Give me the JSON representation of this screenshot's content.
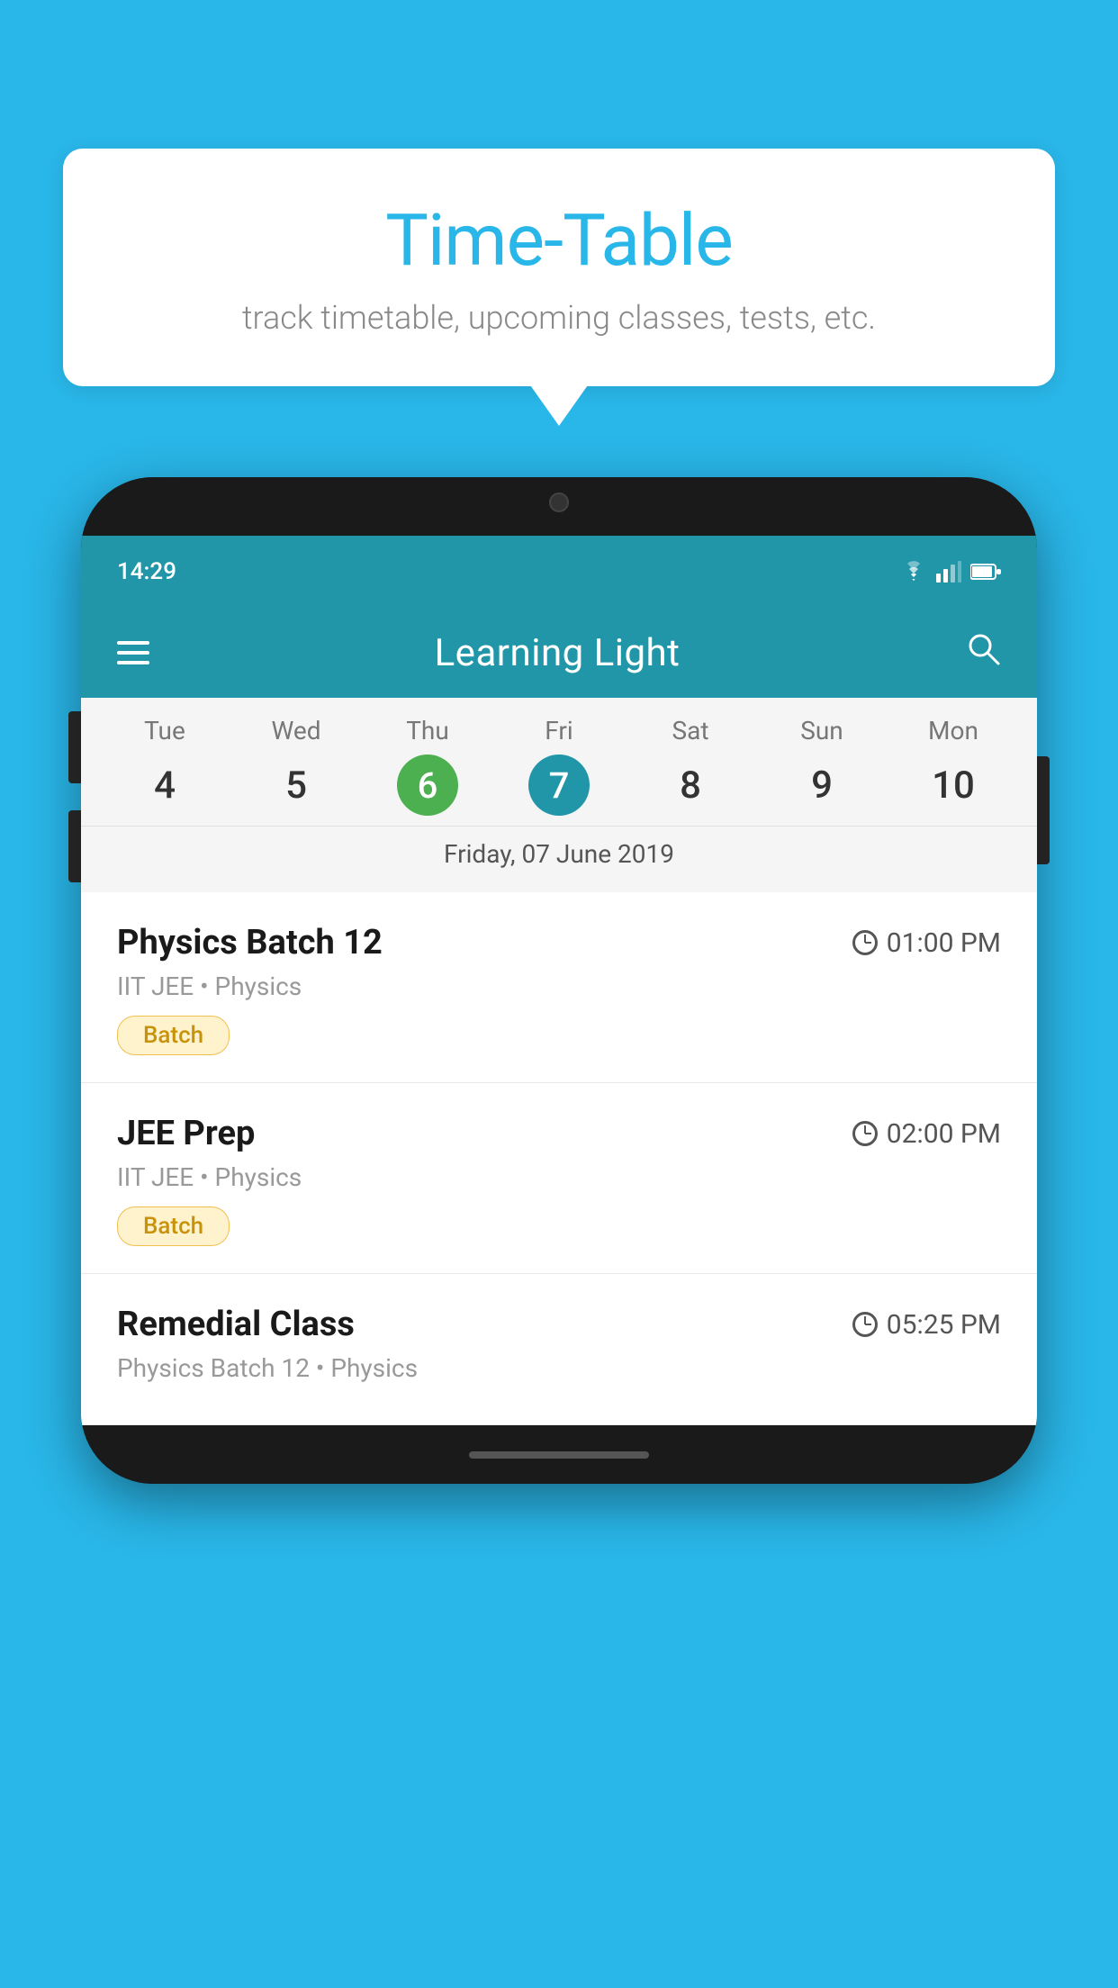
{
  "background_color": "#29b6e8",
  "bubble": {
    "title": "Time-Table",
    "subtitle": "track timetable, upcoming classes, tests, etc."
  },
  "app": {
    "title": "Learning Light",
    "status_time": "14:29"
  },
  "calendar": {
    "days": [
      {
        "label": "Tue",
        "num": "4",
        "state": "normal"
      },
      {
        "label": "Wed",
        "num": "5",
        "state": "normal"
      },
      {
        "label": "Thu",
        "num": "6",
        "state": "today"
      },
      {
        "label": "Fri",
        "num": "7",
        "state": "selected"
      },
      {
        "label": "Sat",
        "num": "8",
        "state": "normal"
      },
      {
        "label": "Sun",
        "num": "9",
        "state": "normal"
      },
      {
        "label": "Mon",
        "num": "10",
        "state": "normal"
      }
    ],
    "selected_date_label": "Friday, 07 June 2019"
  },
  "schedule": [
    {
      "title": "Physics Batch 12",
      "time": "01:00 PM",
      "subtitle": "IIT JEE • Physics",
      "tag": "Batch"
    },
    {
      "title": "JEE Prep",
      "time": "02:00 PM",
      "subtitle": "IIT JEE • Physics",
      "tag": "Batch"
    },
    {
      "title": "Remedial Class",
      "time": "05:25 PM",
      "subtitle": "Physics Batch 12 • Physics",
      "tag": ""
    }
  ]
}
